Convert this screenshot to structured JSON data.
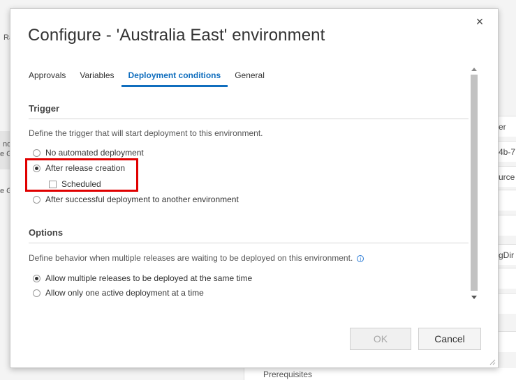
{
  "background": {
    "left_fragments": [
      "Ra",
      "nd",
      "e G",
      "e G"
    ],
    "right_fragments": [
      "er",
      "4b-7",
      "urce",
      "gDir"
    ],
    "bottom_label": "Prerequisites"
  },
  "dialog": {
    "title": "Configure - 'Australia East' environment",
    "close_label": "×",
    "tabs": [
      {
        "label": "Approvals",
        "active": false
      },
      {
        "label": "Variables",
        "active": false
      },
      {
        "label": "Deployment conditions",
        "active": true
      },
      {
        "label": "General",
        "active": false
      }
    ],
    "trigger": {
      "title": "Trigger",
      "description": "Define the trigger that will start deployment to this environment.",
      "options": [
        {
          "label": "No automated deployment",
          "checked": false
        },
        {
          "label": "After release creation",
          "checked": true
        },
        {
          "label": "After successful deployment to another environment",
          "checked": false
        }
      ],
      "scheduled_label": "Scheduled",
      "scheduled_checked": false
    },
    "options_section": {
      "title": "Options",
      "description": "Define behavior when multiple releases are waiting to be deployed on this environment.",
      "info_icon": "info-icon",
      "choices": [
        {
          "label": "Allow multiple releases to be deployed at the same time",
          "checked": true
        },
        {
          "label": "Allow only one active deployment at a time",
          "checked": false
        }
      ]
    },
    "buttons": {
      "ok_label": "OK",
      "cancel_label": "Cancel"
    }
  },
  "colors": {
    "accent": "#106ebe",
    "highlight": "#e00000"
  }
}
